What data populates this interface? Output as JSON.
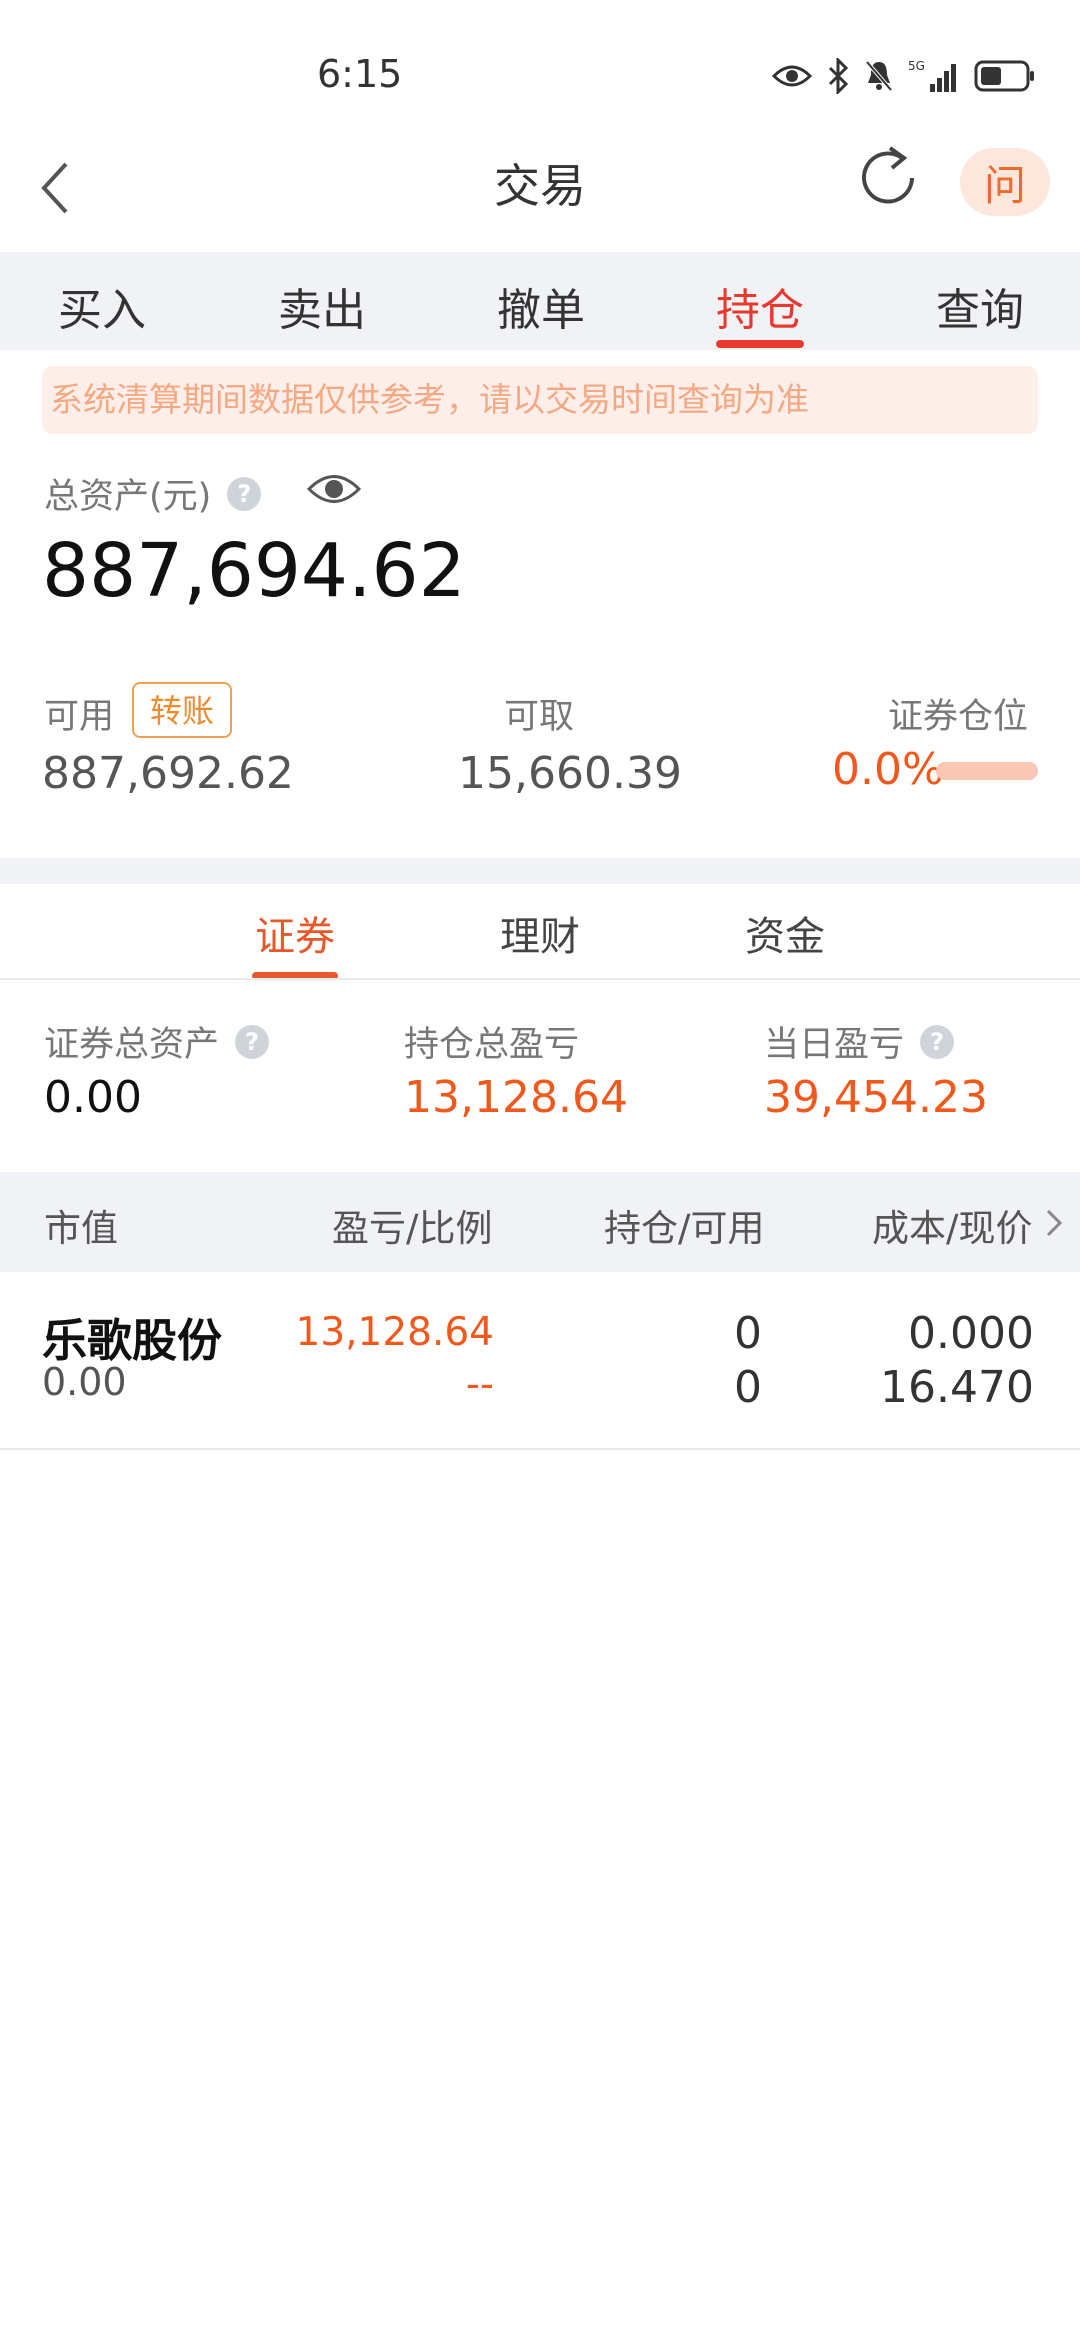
{
  "status_bar": {
    "time": "6:15",
    "network": "5G"
  },
  "header": {
    "title": "交易",
    "ask_label": "问"
  },
  "tabs": [
    {
      "label": "买入",
      "active": false
    },
    {
      "label": "卖出",
      "active": false
    },
    {
      "label": "撤单",
      "active": false
    },
    {
      "label": "持仓",
      "active": true
    },
    {
      "label": "查询",
      "active": false
    }
  ],
  "notice": "系统清算期间数据仅供参考，请以交易时间查询为准",
  "assets": {
    "total_label": "总资产(元)",
    "total_value": "887,694.62",
    "available_label": "可用",
    "transfer_label": "转账",
    "available_value": "887,692.62",
    "withdrawable_label": "可取",
    "withdrawable_value": "15,660.39",
    "position_label": "证券仓位",
    "position_value": "0.0%",
    "position_ratio": 0.0
  },
  "sub_tabs": [
    {
      "label": "证券",
      "active": true
    },
    {
      "label": "理财",
      "active": false
    },
    {
      "label": "资金",
      "active": false
    }
  ],
  "summary": {
    "securities_total_label": "证券总资产",
    "securities_total_value": "0.00",
    "holding_pnl_label": "持仓总盈亏",
    "holding_pnl_value": "13,128.64",
    "daily_pnl_label": "当日盈亏",
    "daily_pnl_value": "39,454.23"
  },
  "table": {
    "headers": [
      "市值",
      "盈亏/比例",
      "持仓/可用",
      "成本/现价"
    ],
    "rows": [
      {
        "name": "乐歌股份",
        "market_value": "0.00",
        "pnl": "13,128.64",
        "pnl_ratio": "--",
        "holding": "0",
        "available": "0",
        "cost": "0.000",
        "price": "16.470"
      }
    ]
  },
  "colors": {
    "accent_red": "#e8392f",
    "profit_orange": "#f0581c",
    "tab_bg": "#f0f2f6"
  }
}
